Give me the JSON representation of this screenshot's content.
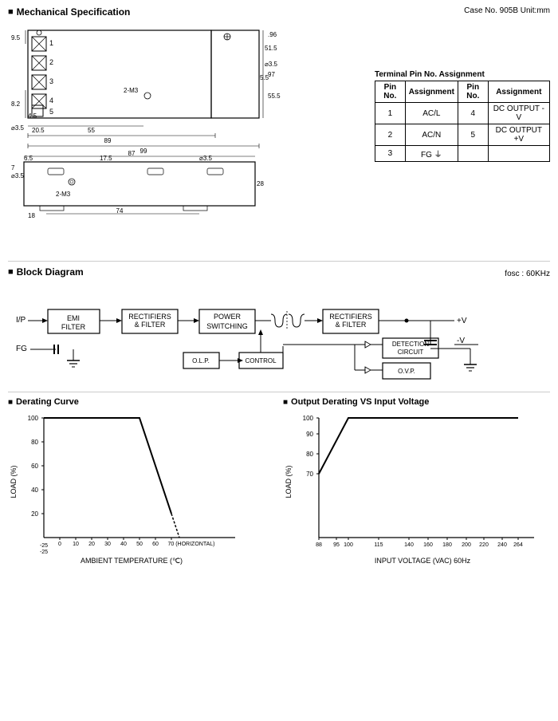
{
  "mechanical": {
    "title": "Mechanical Specification",
    "case_info": "Case No. 905B  Unit:mm",
    "terminal_table": {
      "caption": "Terminal Pin No. Assignment",
      "headers": [
        "Pin No.",
        "Assignment",
        "Pin No.",
        "Assignment"
      ],
      "rows": [
        [
          "1",
          "AC/L",
          "4",
          "DC OUTPUT -V"
        ],
        [
          "2",
          "AC/N",
          "5",
          "DC OUTPUT +V"
        ],
        [
          "3",
          "FG ⏚",
          "",
          ""
        ]
      ]
    }
  },
  "block_diagram": {
    "title": "Block Diagram",
    "fosc": "fosc : 60KHz",
    "blocks": [
      "EMI FILTER",
      "RECTIFIERS & FILTER",
      "POWER SWITCHING",
      "RECTIFIERS & FILTER",
      "DETECTION CIRCUIT",
      "O.L.P.",
      "CONTROL",
      "O.V.P."
    ],
    "labels": [
      "I/P",
      "FG",
      "+V",
      "-V"
    ]
  },
  "derating": {
    "title": "Derating Curve",
    "x_label": "AMBIENT TEMPERATURE (℃)",
    "y_label": "LOAD (%)",
    "x_values": [
      "-25",
      "-25",
      "0",
      "10",
      "20",
      "30",
      "40",
      "50",
      "60",
      "70 (HORIZONTAL)"
    ],
    "y_values": [
      "100",
      "80",
      "60",
      "40",
      "20"
    ]
  },
  "output_derating": {
    "title": "Output Derating VS Input Voltage",
    "x_label": "INPUT VOLTAGE (VAC) 60Hz",
    "y_label": "LOAD (%)",
    "x_values": [
      "88",
      "95",
      "100",
      "115",
      "140",
      "160",
      "180",
      "200",
      "220",
      "240",
      "264"
    ],
    "y_values": [
      "100",
      "90",
      "80",
      "70"
    ]
  }
}
